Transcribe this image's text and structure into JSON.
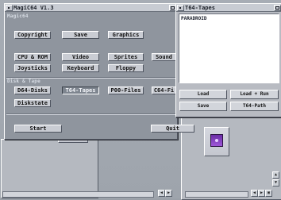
{
  "windows": {
    "main": {
      "title": "MagiC64 V1.3",
      "section_labels": {
        "top": "Magic64",
        "disk_tape": "Disk & Tape"
      },
      "buttons": {
        "copyright": "Copyright",
        "save": "Save",
        "graphics": "Graphics",
        "cpu_rom": "CPU & ROM",
        "video": "Video",
        "sprites": "Sprites",
        "sound": "Sound",
        "joysticks": "Joysticks",
        "keyboard": "Keyboard",
        "floppy": "Floppy",
        "d64_disks": "D64-Disks",
        "t64_tapes": "T64-Tapes",
        "p00_files": "P00-Files",
        "c64_files": "C64-Fi",
        "diskstate": "Diskstate",
        "start": "Start",
        "quit": "Quit"
      }
    },
    "tapes": {
      "title": "T64-Tapes",
      "list_item": "PARADROID",
      "buttons": {
        "load": "Load",
        "load_run": "Load + Run",
        "save": "Save",
        "t64_path": "T64-Path"
      }
    }
  },
  "desktop": {
    "icon_name": "tape-icon"
  }
}
